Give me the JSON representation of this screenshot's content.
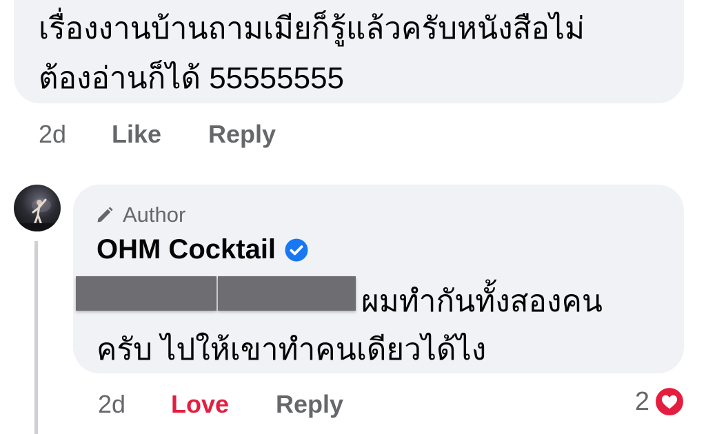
{
  "top_comment": {
    "text_line1": "เรื่องงานบ้านถามเมียก็รู้แล้วครับหนังสือไม่",
    "text_line2": "ต้องอ่านก็ได้ 55555555",
    "time": "2d",
    "like_label": "Like",
    "reply_label": "Reply"
  },
  "reply_comment": {
    "badge_label": "Author",
    "author_name": "OHM Cocktail",
    "text_line1": "ผมทำกันทั้งสองคน",
    "text_line2": "ครับ  ไปให้เขาทำคนเดียวได้ไง",
    "time": "2d",
    "love_label": "Love",
    "reply_label": "Reply",
    "reaction_count": "2"
  },
  "colors": {
    "bubble": "#f0f2f5",
    "meta_gray": "#65676b",
    "love_red": "#e41e3f",
    "verified_blue": "#1877f2"
  },
  "icons": {
    "author_badge": "pencil-icon",
    "verified": "verified-badge-icon",
    "reaction": "love-reaction-icon"
  }
}
